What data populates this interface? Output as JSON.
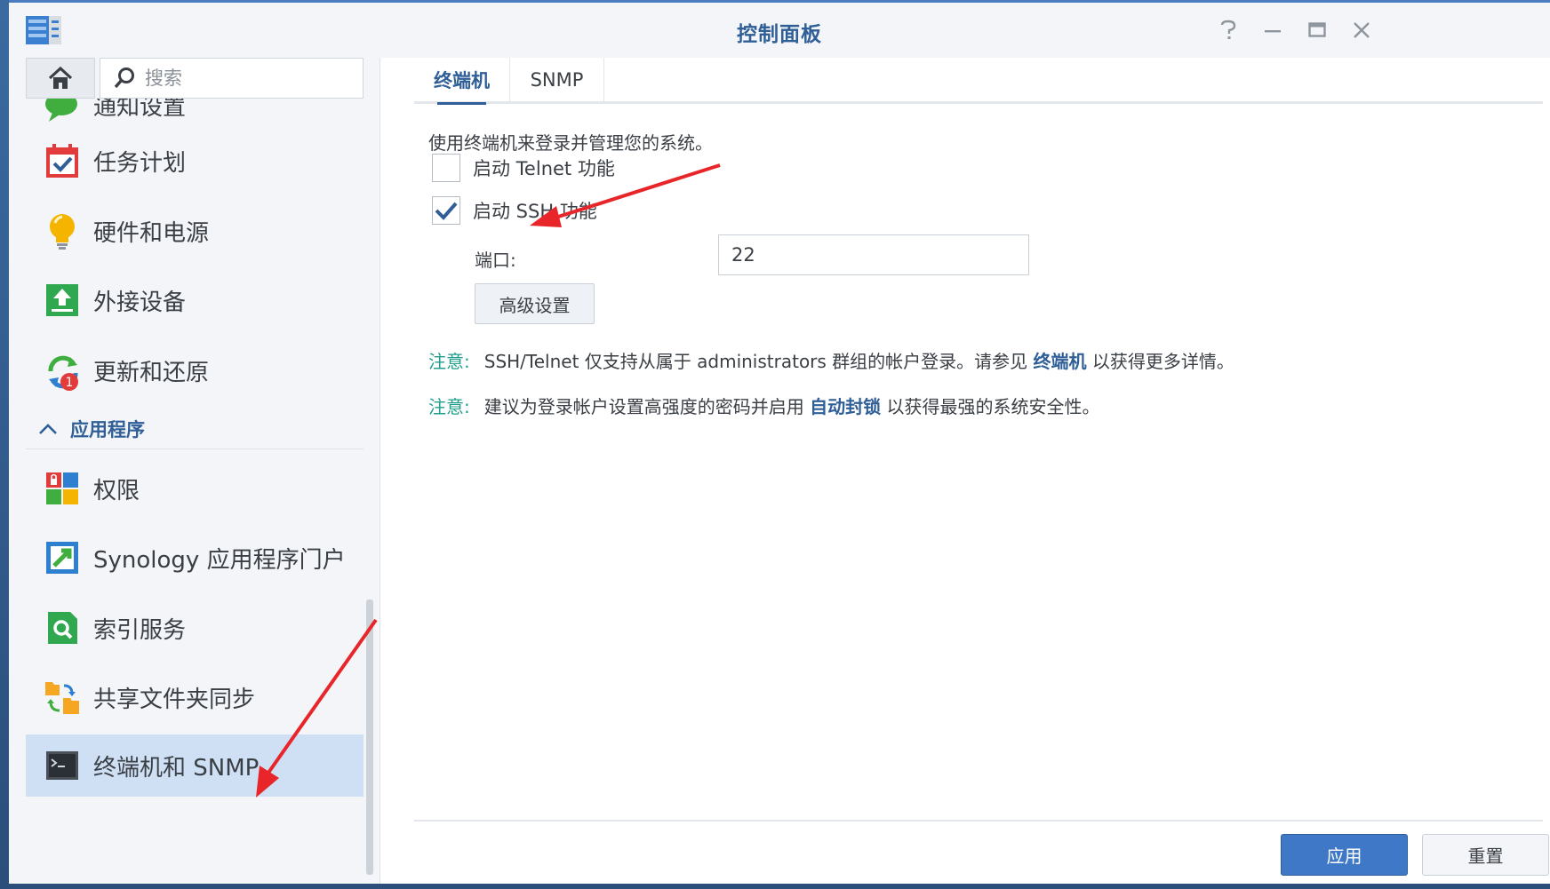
{
  "window": {
    "title": "控制面板"
  },
  "search": {
    "placeholder": "搜索"
  },
  "sidebar": {
    "items": [
      {
        "label": "通知设置",
        "icon": "notification-icon"
      },
      {
        "label": "任务计划",
        "icon": "calendar-check-icon"
      },
      {
        "label": "硬件和电源",
        "icon": "lightbulb-icon"
      },
      {
        "label": "外接设备",
        "icon": "external-device-icon"
      },
      {
        "label": "更新和还原",
        "icon": "update-restore-icon",
        "badge": "1"
      }
    ],
    "section": {
      "label": "应用程序",
      "icon": "chevron-up-icon"
    },
    "apps": [
      {
        "label": "权限",
        "icon": "permissions-icon"
      },
      {
        "label": "Synology 应用程序门户",
        "icon": "app-portal-icon"
      },
      {
        "label": "索引服务",
        "icon": "index-service-icon"
      },
      {
        "label": "共享文件夹同步",
        "icon": "folder-sync-icon"
      },
      {
        "label": "终端机和 SNMP",
        "icon": "terminal-icon"
      }
    ]
  },
  "tabs": [
    {
      "label": "终端机",
      "active": true
    },
    {
      "label": "SNMP",
      "active": false
    }
  ],
  "terminal": {
    "description": "使用终端机来登录并管理您的系统。",
    "telnet_label": "启动 Telnet 功能",
    "telnet_checked": false,
    "ssh_label": "启动 SSH 功能",
    "ssh_checked": true,
    "port_label": "端口:",
    "port_value": "22",
    "advanced_button": "高级设置"
  },
  "notes": [
    {
      "tag": "注意:",
      "text_before": "SSH/Telnet 仅支持从属于 administrators 群组的帐户登录。请参见",
      "link": "终端机",
      "text_after": "以获得更多详情。"
    },
    {
      "tag": "注意:",
      "text_before": "建议为登录帐户设置高强度的密码并启用",
      "link": "自动封锁",
      "text_after": "以获得最强的系统安全性。"
    }
  ],
  "footer": {
    "apply_label": "应用",
    "reset_label": "重置"
  },
  "colors": {
    "accent": "#2f5f96",
    "note_tag": "#1f9f8c",
    "apply_bg": "#3f78c6",
    "active_item_bg": "#cfe0f5",
    "annotation_arrow": "#e8262a"
  }
}
